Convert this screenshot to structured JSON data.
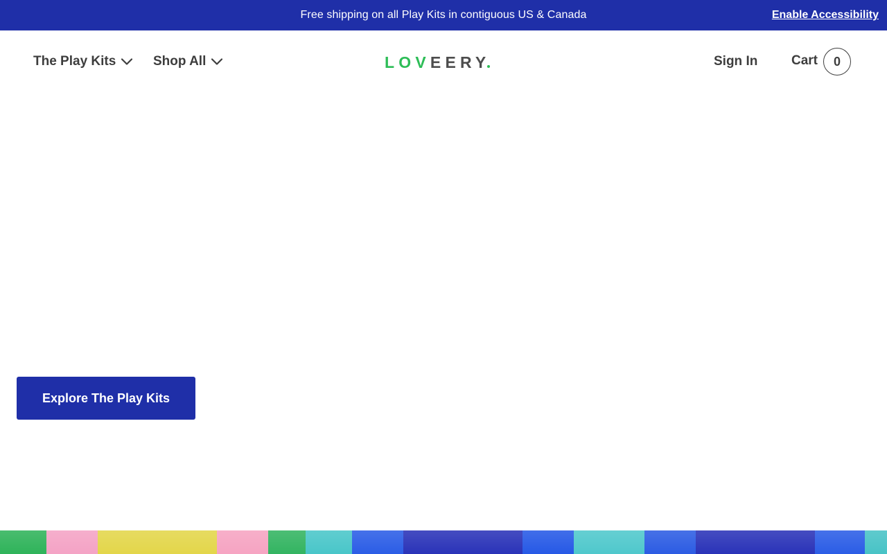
{
  "announcement": {
    "text": "Free shipping on all Play Kits in contiguous US & Canada",
    "accessibility_link": "Enable Accessibility",
    "background_color": "#1f2fa8"
  },
  "header": {
    "nav": [
      {
        "label": "The Play Kits",
        "icon": "chevron-down-icon"
      },
      {
        "label": "Shop All",
        "icon": "chevron-down-icon"
      }
    ],
    "logo": {
      "part1": "LOV",
      "part2": "ERY",
      "middle": "E",
      "colors": {
        "accent": "#2dbd57",
        "neutral": "#4d4d4d"
      }
    },
    "sign_in": "Sign In",
    "cart": {
      "label": "Cart",
      "count": "0"
    }
  },
  "hero": {
    "cta_label": "Explore The Play Kits",
    "cta_color": "#1f2fa8"
  },
  "decor_strip": {
    "colors": [
      "#2fb35a",
      "#f4a3c5",
      "#e3d64a",
      "#f6a4c2",
      "#33b461",
      "#49c6c9",
      "#2b5de6",
      "#2a33b8",
      "#2659e6",
      "#4fc8cc",
      "#2c5ce3",
      "#2a33b8",
      "#2b5de6",
      "#48c3c6"
    ]
  }
}
